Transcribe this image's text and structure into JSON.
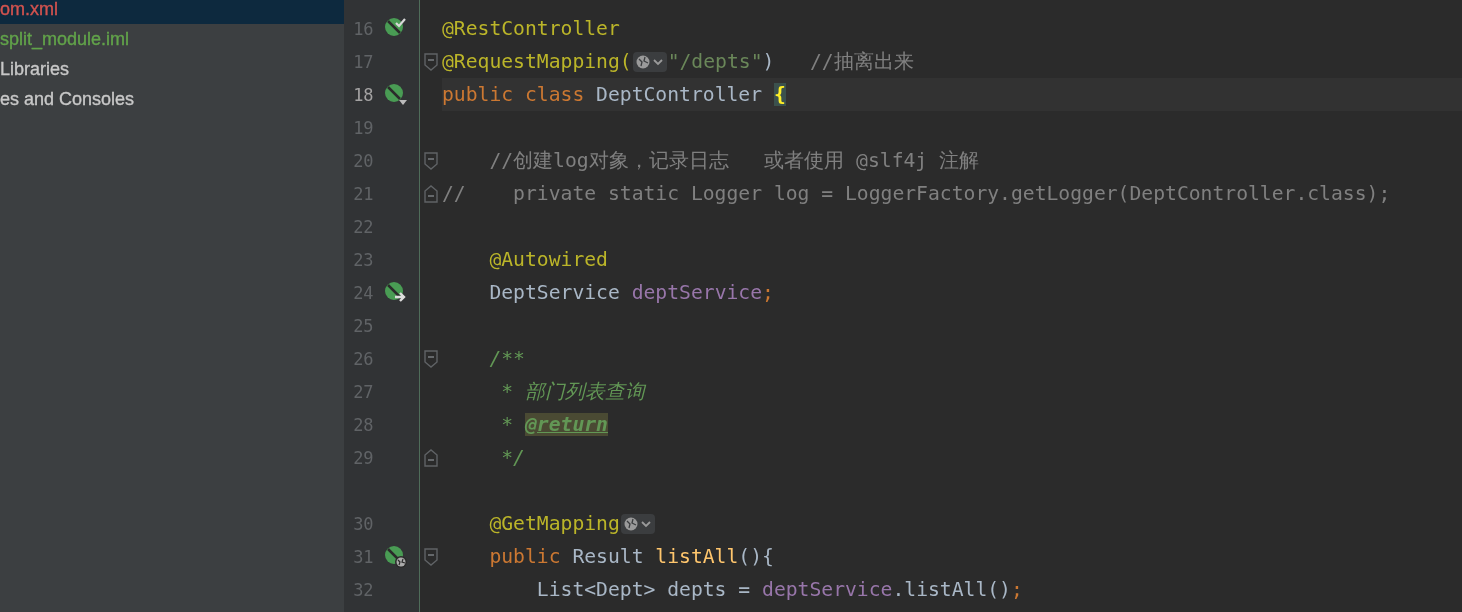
{
  "sidebar": {
    "items": [
      {
        "label": "om.xml",
        "selected": true,
        "color": "#d2534f"
      },
      {
        "label": "split_module.iml",
        "selected": false,
        "color": "#62a34a"
      },
      {
        "label": "Libraries",
        "selected": false,
        "color": "#c8c8c8"
      },
      {
        "label": "es and Consoles",
        "selected": false,
        "color": "#c8c8c8"
      }
    ]
  },
  "editor": {
    "lines": [
      {
        "kind": "code",
        "number": "16",
        "gutter_icon": {
          "kind": "bean-check"
        },
        "current": false,
        "tokens": [
          {
            "text": "@RestController",
            "kind": "ann"
          }
        ]
      },
      {
        "kind": "code",
        "number": "17",
        "fold_marker": {
          "kind": "start"
        },
        "current": false,
        "tokens": [
          {
            "text": "@RequestMapping(",
            "kind": "ann"
          },
          {
            "kind": "inlay"
          },
          {
            "text": "\"/depts\"",
            "kind": "string"
          },
          {
            "text": ")",
            "kind": "plain"
          },
          {
            "text": "   //抽离出来",
            "kind": "comment"
          }
        ]
      },
      {
        "kind": "code",
        "number": "18",
        "gutter_icon": {
          "kind": "bean-caret"
        },
        "current": true,
        "tokens": [
          {
            "text": "public ",
            "kind": "kw"
          },
          {
            "text": "class",
            "kind": "kw"
          },
          {
            "text": " DeptController ",
            "kind": "plain"
          },
          {
            "text": "{",
            "kind": "brace"
          }
        ]
      },
      {
        "kind": "code",
        "number": "19",
        "current": false
      },
      {
        "kind": "code",
        "number": "20",
        "fold_marker": {
          "kind": "start"
        },
        "current": false,
        "tokens": [
          {
            "text": "    //创建log对象，记录日志   或者使用 @slf4j 注解",
            "kind": "comment"
          }
        ]
      },
      {
        "kind": "code",
        "number": "21",
        "fold_marker": {
          "kind": "end"
        },
        "current": false,
        "tokens": [
          {
            "text": "//    private static Logger log = LoggerFactory.getLogger(DeptController.class);",
            "kind": "comment"
          }
        ]
      },
      {
        "kind": "code",
        "number": "22",
        "current": false
      },
      {
        "kind": "code",
        "number": "23",
        "current": false,
        "tokens": [
          {
            "text": "    @Autowired",
            "kind": "ann"
          }
        ]
      },
      {
        "kind": "code",
        "number": "24",
        "gutter_icon": {
          "kind": "bean-arrow"
        },
        "current": false,
        "tokens": [
          {
            "text": "    DeptService ",
            "kind": "plain"
          },
          {
            "text": "deptService",
            "kind": "field"
          },
          {
            "text": ";",
            "kind": "kw"
          }
        ]
      },
      {
        "kind": "code",
        "number": "25",
        "current": false
      },
      {
        "kind": "code",
        "number": "26",
        "fold_marker": {
          "kind": "start"
        },
        "current": false,
        "tokens": [
          {
            "text": "    /**",
            "kind": "doc"
          }
        ]
      },
      {
        "kind": "code",
        "number": "27",
        "current": false,
        "tokens": [
          {
            "text": "     * 部门列表查询",
            "kind": "doc"
          }
        ]
      },
      {
        "kind": "code",
        "number": "28",
        "current": false,
        "tokens": [
          {
            "text": "     * ",
            "kind": "doc"
          },
          {
            "text": "@return",
            "kind": "doctag"
          }
        ]
      },
      {
        "kind": "code",
        "number": "29",
        "fold_marker": {
          "kind": "end"
        },
        "current": false,
        "tokens": [
          {
            "text": "     */",
            "kind": "doc"
          }
        ]
      },
      {
        "kind": "spacer"
      },
      {
        "kind": "code",
        "number": "30",
        "current": false,
        "tokens": [
          {
            "text": "    @GetMapping",
            "kind": "ann"
          },
          {
            "kind": "inlay"
          }
        ]
      },
      {
        "kind": "code",
        "number": "31",
        "gutter_icon": {
          "kind": "bean-globe"
        },
        "fold_marker": {
          "kind": "start"
        },
        "current": false,
        "tokens": [
          {
            "text": "    public",
            "kind": "kw"
          },
          {
            "text": " Result ",
            "kind": "plain"
          },
          {
            "text": "listAll",
            "kind": "method"
          },
          {
            "text": "(){",
            "kind": "plain"
          }
        ]
      },
      {
        "kind": "code",
        "number": "32",
        "current": false,
        "tokens": [
          {
            "text": "        List<Dept> depts = ",
            "kind": "plain"
          },
          {
            "text": "deptService",
            "kind": "field"
          },
          {
            "text": ".listAll()",
            "kind": "plain"
          },
          {
            "text": ";",
            "kind": "kw"
          }
        ]
      }
    ]
  }
}
